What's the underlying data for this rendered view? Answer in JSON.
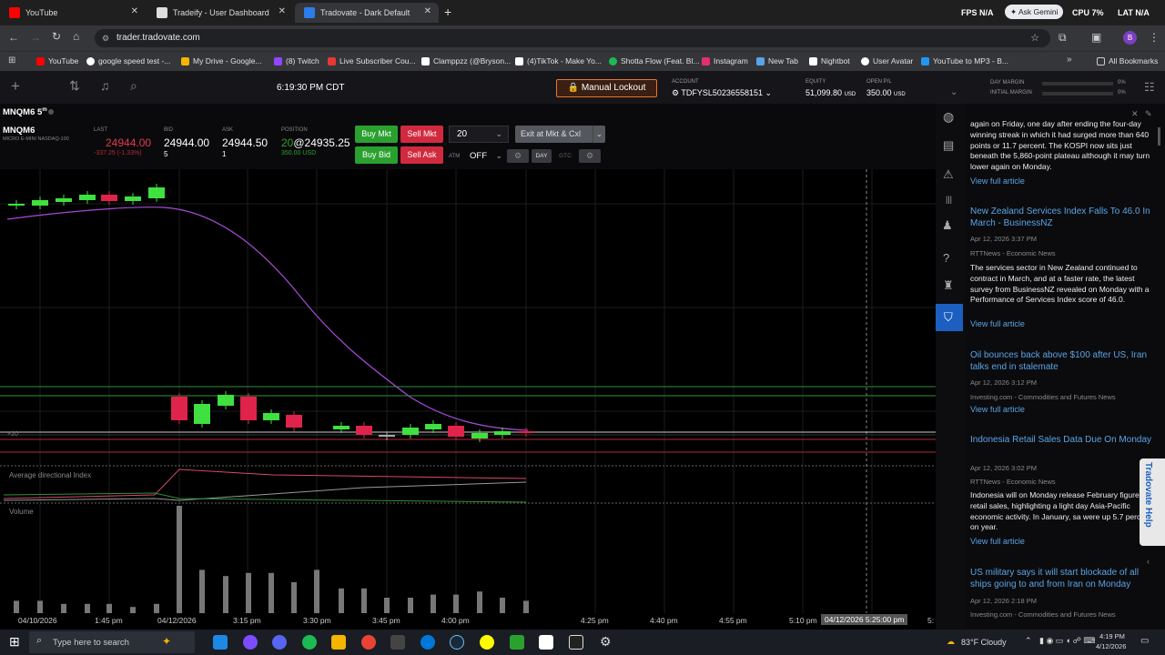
{
  "browser": {
    "tabs": [
      {
        "title": "YouTube",
        "color": "#ff0000"
      },
      {
        "title": "Tradeify - User Dashboard",
        "color": "#dddddd"
      },
      {
        "title": "Tradovate - Dark Default",
        "color": "#2b7de9"
      }
    ],
    "new_tab": "+",
    "ext_labels": {
      "fps": "FPS",
      "fps_val": "N/A",
      "ask_gemini": "Ask Gemini",
      "cpu": "CPU",
      "cpu_val": "7%",
      "lat": "LAT",
      "lat_val": "N/A"
    },
    "url": "trader.tradovate.com",
    "profile": "B",
    "bookmarks": [
      {
        "label": "YouTube",
        "color": "#ff0000"
      },
      {
        "label": "google speed test -...",
        "color": "#ffffff"
      },
      {
        "label": "My Drive - Google...",
        "color": "#f4b400"
      },
      {
        "label": "(8) Twitch",
        "color": "#9146ff"
      },
      {
        "label": "Live Subscriber Cou...",
        "color": "#e53935"
      },
      {
        "label": "Clamppzz (@Bryson...",
        "color": "#ffffff"
      },
      {
        "label": "(4)TikTok - Make Yo...",
        "color": "#ffffff"
      },
      {
        "label": "Shotta Flow (Feat. Bl...",
        "color": "#1db954"
      },
      {
        "label": "Instagram",
        "color": "#e1306c"
      },
      {
        "label": "New Tab",
        "color": "#5aa5e6"
      },
      {
        "label": "Nightbot",
        "color": "#ffffff"
      },
      {
        "label": "User Avatar",
        "color": "#ffffff"
      },
      {
        "label": "YouTube to MP3 - B...",
        "color": "#2196f3"
      }
    ],
    "all_bookmarks": "All Bookmarks"
  },
  "app": {
    "clock": "6:19:30 PM CDT",
    "manual_lockout": "Manual Lockout",
    "account_label": "ACCOUNT",
    "account_value": "TDFYSL50236558151",
    "equity_label": "EQUITY",
    "equity_value": "51,099.80",
    "equity_unit": "USD",
    "open_pl_label": "OPEN P/L",
    "open_pl_value": "350.00",
    "open_pl_unit": "USD",
    "day_margin_label": "DAY MARGIN",
    "day_margin_pct": "0%",
    "initial_margin_label": "INITIAL MARGIN",
    "initial_margin_pct": "0%"
  },
  "symbol": {
    "name": "MNQM6",
    "timeframe": "5",
    "timeframe_unit": "m",
    "code": "MNQM6",
    "description": "MICRO E-MINI NASDAQ-100",
    "last_label": "LAST",
    "last": "24944.00",
    "last_change": "-337.25 (-1.33%)",
    "bid_label": "BID",
    "bid": "24944.00",
    "bid_size": "5",
    "ask_label": "ASK",
    "ask": "24944.50",
    "ask_size": "1",
    "position_label": "POSITION",
    "position_qty": "20",
    "position_price": "@24935.25",
    "position_usd": "350.00 USD"
  },
  "order": {
    "buy_mkt": "Buy Mkt",
    "sell_mkt": "Sell Mkt",
    "buy_bid": "Buy Bid",
    "sell_ask": "Sell Ask",
    "quantity": "20",
    "exit": "Exit at Mkt & Cxl",
    "atm_label": "ATM",
    "atm_value": "OFF",
    "day": "DAY",
    "gtc": "GTC"
  },
  "chart": {
    "adx_label": "Average directional Index",
    "volume_label": "Volume",
    "position_marker": "+20",
    "crosshair_time": "04/12/2026 5:25:00 pm",
    "x_ticks": [
      "04/10/2026",
      "1:45 pm",
      "04/12/2026",
      "3:15 pm",
      "3:30 pm",
      "3:45 pm",
      "4:00 pm",
      "4:25 pm",
      "4:40 pm",
      "4:55 pm",
      "5:10 pm",
      "5:"
    ]
  },
  "chart_data": {
    "type": "candlestick",
    "candles": [
      {
        "o": 0,
        "c": 0,
        "dir": "up"
      },
      {
        "dir": "up"
      },
      {
        "dir": "up"
      },
      {
        "dir": "up"
      },
      {
        "dir": "down"
      },
      {
        "dir": "up"
      },
      {
        "dir": "up"
      },
      {
        "dir": "down"
      },
      {
        "dir": "up"
      },
      {
        "dir": "up"
      },
      {
        "dir": "down"
      },
      {
        "dir": "up"
      },
      {
        "dir": "down"
      },
      {
        "dir": "up"
      },
      {
        "dir": "down"
      },
      {
        "dir": "flat"
      },
      {
        "dir": "up"
      },
      {
        "dir": "up"
      },
      {
        "dir": "down"
      },
      {
        "dir": "up"
      },
      {
        "dir": "up"
      }
    ],
    "volume": [
      4,
      4,
      3,
      3,
      3,
      2,
      3,
      35,
      14,
      12,
      13,
      13,
      10,
      14,
      8,
      8,
      5,
      5,
      6,
      6,
      7,
      5,
      4,
      4
    ]
  },
  "news": {
    "items": [
      {
        "title": "",
        "date": "",
        "source": "",
        "body": "again on Friday, one day after ending the four-day winning streak in which it had surged more than 640 points or 11.7 percent. The KOSPI now sits just beneath the 5,860-point plateau although it may turn lower again on Monday.",
        "link": "View full article"
      },
      {
        "title": "New Zealand Services Index Falls To 46.0 In March - BusinessNZ",
        "date": "Apr 12, 2026 3:37 PM",
        "source": "RTTNews - Economic News",
        "body": "The services sector in New Zealand continued to contract in March, and at a faster rate, the latest survey from BusinessNZ revealed on Monday with a Performance of Services Index score of 46.0.",
        "link": "View full article"
      },
      {
        "title": "Oil bounces back above $100 after US, Iran talks end in stalemate",
        "date": "Apr 12, 2026 3:12 PM",
        "source": "Investing.com - Commodities and Futures News",
        "body": "",
        "link": "View full article"
      },
      {
        "title": "Indonesia Retail Sales Data Due On Monday",
        "date": "Apr 12, 2026 3:02 PM",
        "source": "RTTNews - Economic News",
        "body": "Indonesia will on Monday release February figures for retail sales, highlighting a light day Asia-Pacific economic activity. In January, sa were up 5.7 percent on year.",
        "link": "View full article"
      },
      {
        "title": "US military says it will start blockade of all ships going to and from Iran on Monday",
        "date": "Apr 12, 2026 2:18 PM",
        "source": "Investing.com - Commodities and Futures News",
        "body": "",
        "link": ""
      }
    ],
    "help_tab": "Tradovate Help"
  },
  "taskbar": {
    "search_placeholder": "Type here to search",
    "weather": "83°F  Cloudy",
    "time": "4:19 PM",
    "date": "4/12/2026"
  }
}
